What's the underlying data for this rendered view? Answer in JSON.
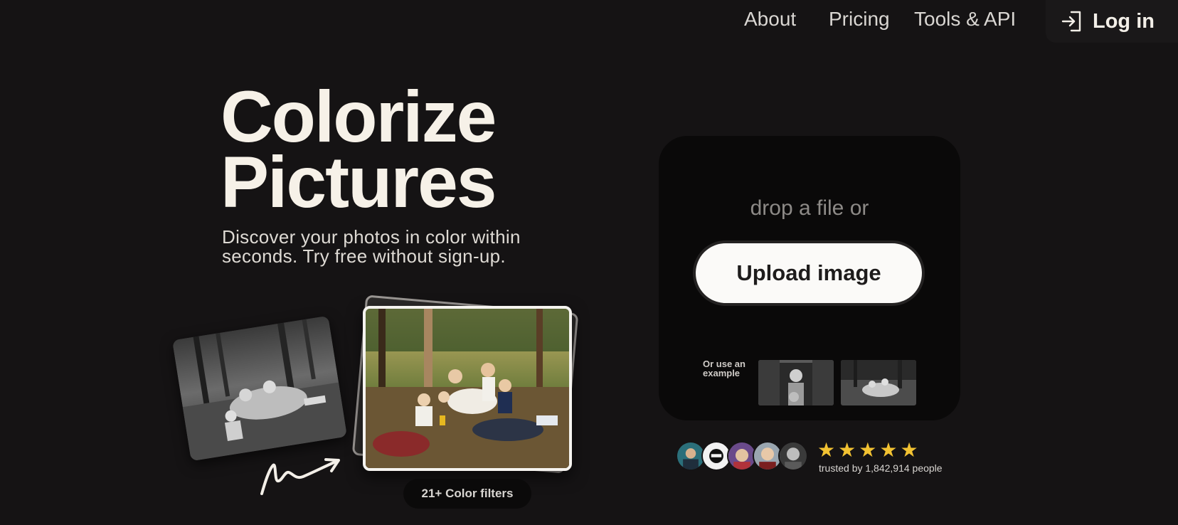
{
  "nav": {
    "about": "About",
    "pricing": "Pricing",
    "tools": "Tools & API",
    "login": "Log in"
  },
  "hero": {
    "title_line1": "Colorize",
    "title_line2": "Pictures",
    "subtitle": "Discover your photos in color within seconds. Try free without sign-up."
  },
  "showcase": {
    "filters_label": "21+ Color filters"
  },
  "upload": {
    "drop_text": "drop a file or",
    "button_label": "Upload image",
    "example_label": "Or use an example"
  },
  "trust": {
    "rating_stars": 5,
    "stars": [
      "★",
      "★",
      "★",
      "★",
      "★"
    ],
    "trusted_text": "trusted by 1,842,914 people"
  },
  "colors": {
    "background": "#151314",
    "card": "#0a0909",
    "star": "#f2c232",
    "title": "#f6f1e8"
  }
}
